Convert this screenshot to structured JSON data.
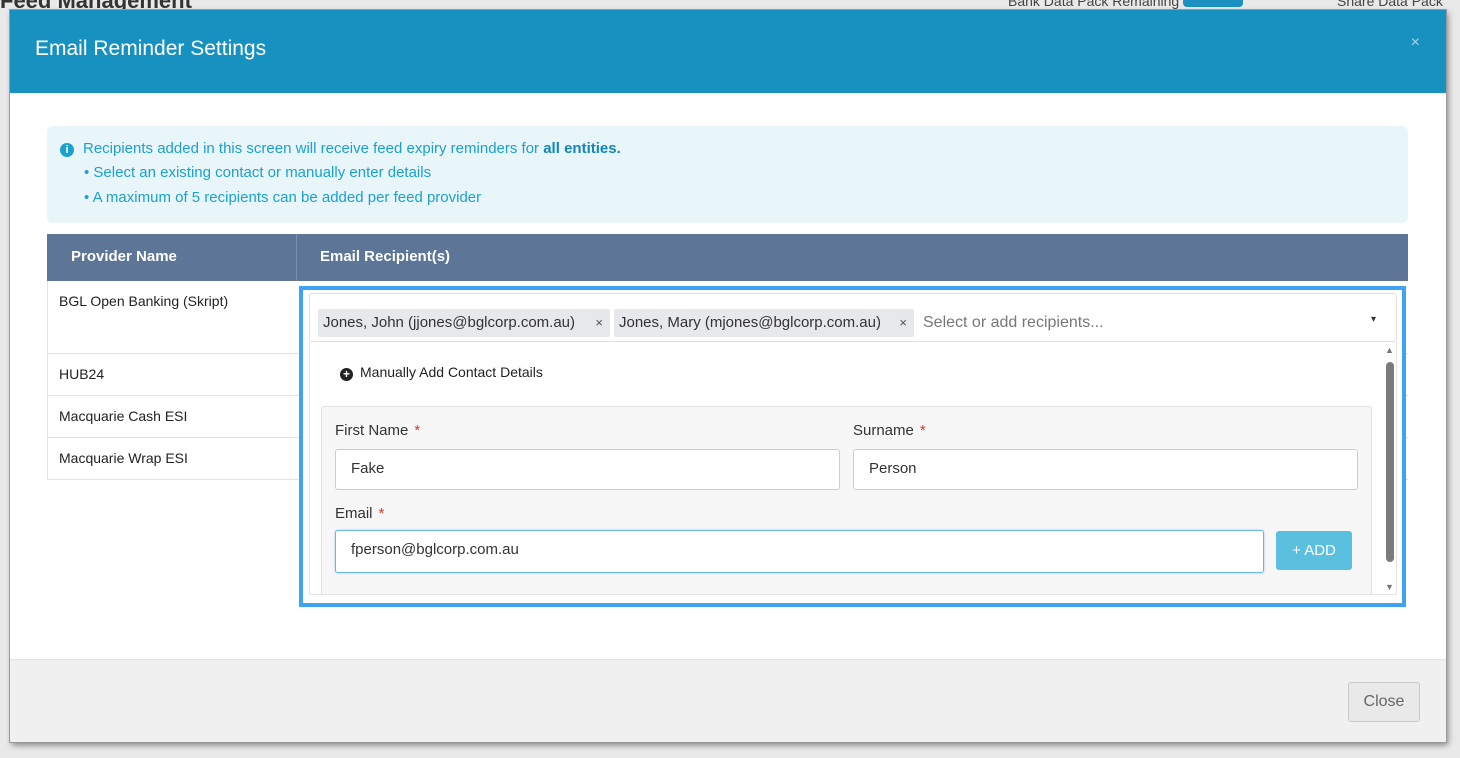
{
  "background": {
    "title": "Feed Management",
    "bank_data_pack": "Bank Data Pack Remaining",
    "share_data_pack": "Share Data Pack"
  },
  "modal": {
    "title": "Email Reminder Settings",
    "close_x": "×",
    "info": {
      "line1": "Recipients added in this screen will receive feed expiry reminders for ",
      "line1_strong": "all entities.",
      "bullet1": "• Select an existing contact or manually enter details",
      "bullet2": "• A maximum of 5 recipients can be added per feed provider"
    },
    "table": {
      "col_provider": "Provider Name",
      "col_email": "Email Recipient(s)",
      "providers": [
        "BGL Open Banking (Skript)",
        "HUB24",
        "Macquarie Cash ESI",
        "Macquarie Wrap ESI"
      ]
    },
    "select": {
      "chips": [
        {
          "label": "Jones, John (jjones@bglcorp.com.au)",
          "remove": "×"
        },
        {
          "label": "Jones, Mary (mjones@bglcorp.com.au)",
          "remove": "×"
        }
      ],
      "placeholder": "Select or add recipients...",
      "caret": "▾"
    },
    "dropdown": {
      "manual_add": "Manually Add Contact Details",
      "first_name_label": "First Name",
      "surname_label": "Surname",
      "email_label": "Email",
      "required_mark": "*",
      "first_name_value": "Fake",
      "surname_value": "Person",
      "email_value": "fperson@bglcorp.com.au",
      "add_button": "+ ADD"
    },
    "footer": {
      "close_label": "Close"
    }
  }
}
